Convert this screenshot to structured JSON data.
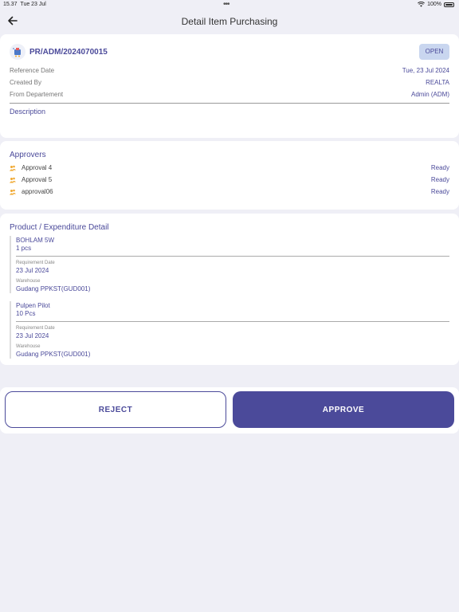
{
  "status_bar": {
    "time": "15.37",
    "date": "Tue 23 Jul",
    "battery": "100%"
  },
  "header": {
    "title": "Detail Item Purchasing",
    "back_icon": "arrow-left-icon"
  },
  "summary": {
    "pr_number": "PR/ADM/2024070015",
    "status": "OPEN",
    "rows": [
      {
        "label": "Reference Date",
        "value": "Tue, 23 Jul 2024"
      },
      {
        "label": "Created By",
        "value": "REALTA"
      },
      {
        "label": "From Departement",
        "value": "Admin (ADM)"
      }
    ],
    "description_label": "Description"
  },
  "approvers": {
    "title": "Approvers",
    "items": [
      {
        "name": "Approval 4",
        "status": "Ready"
      },
      {
        "name": "Approval 5",
        "status": "Ready"
      },
      {
        "name": "approval06",
        "status": "Ready"
      }
    ]
  },
  "products": {
    "title": "Product / Expenditure Detail",
    "items": [
      {
        "name": "BOHLAM 5W",
        "qty": "1 pcs",
        "req_label": "Requirement Date",
        "req_value": "23 Jul 2024",
        "wh_label": "Warehouse",
        "wh_value": "Gudang PPKST(GUD001)"
      },
      {
        "name": "Pulpen Pilot",
        "qty": "10 Pcs",
        "req_label": "Requirement Date",
        "req_value": "23 Jul 2024",
        "wh_label": "Warehouse",
        "wh_value": "Gudang PPKST(GUD001)"
      }
    ]
  },
  "actions": {
    "reject": "REJECT",
    "approve": "APPROVE"
  },
  "colors": {
    "primary": "#4b4a9a",
    "badge_bg": "#c9d6ef",
    "approver_icon": "#f0a830"
  }
}
